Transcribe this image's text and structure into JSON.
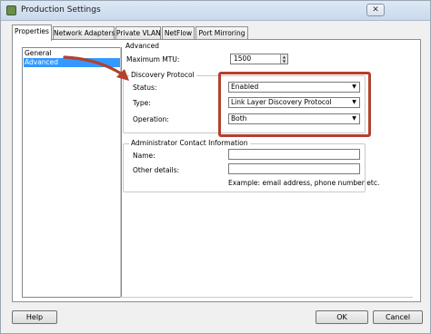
{
  "window": {
    "title": "Production Settings",
    "close_label": "✕"
  },
  "tabs": [
    {
      "label": "Properties"
    },
    {
      "label": "Network Adapters"
    },
    {
      "label": "Private VLAN"
    },
    {
      "label": "NetFlow"
    },
    {
      "label": "Port Mirroring"
    }
  ],
  "nav": {
    "items": [
      {
        "label": "General"
      },
      {
        "label": "Advanced"
      }
    ],
    "selected": "Advanced"
  },
  "advanced": {
    "section_label": "Advanced",
    "max_mtu_label": "Maximum MTU:",
    "max_mtu_value": "1500"
  },
  "discovery": {
    "section_label": "Discovery Protocol",
    "status_label": "Status:",
    "status_value": "Enabled",
    "type_label": "Type:",
    "type_value": "Link Layer Discovery Protocol",
    "operation_label": "Operation:",
    "operation_value": "Both"
  },
  "admin": {
    "section_label": "Administrator Contact Information",
    "name_label": "Name:",
    "name_value": "",
    "other_label": "Other details:",
    "other_value": "",
    "example_text": "Example: email address, phone number etc."
  },
  "buttons": {
    "help": "Help",
    "ok": "OK",
    "cancel": "Cancel"
  },
  "colors": {
    "highlight": "#b3412e",
    "selection": "#3399ff"
  }
}
